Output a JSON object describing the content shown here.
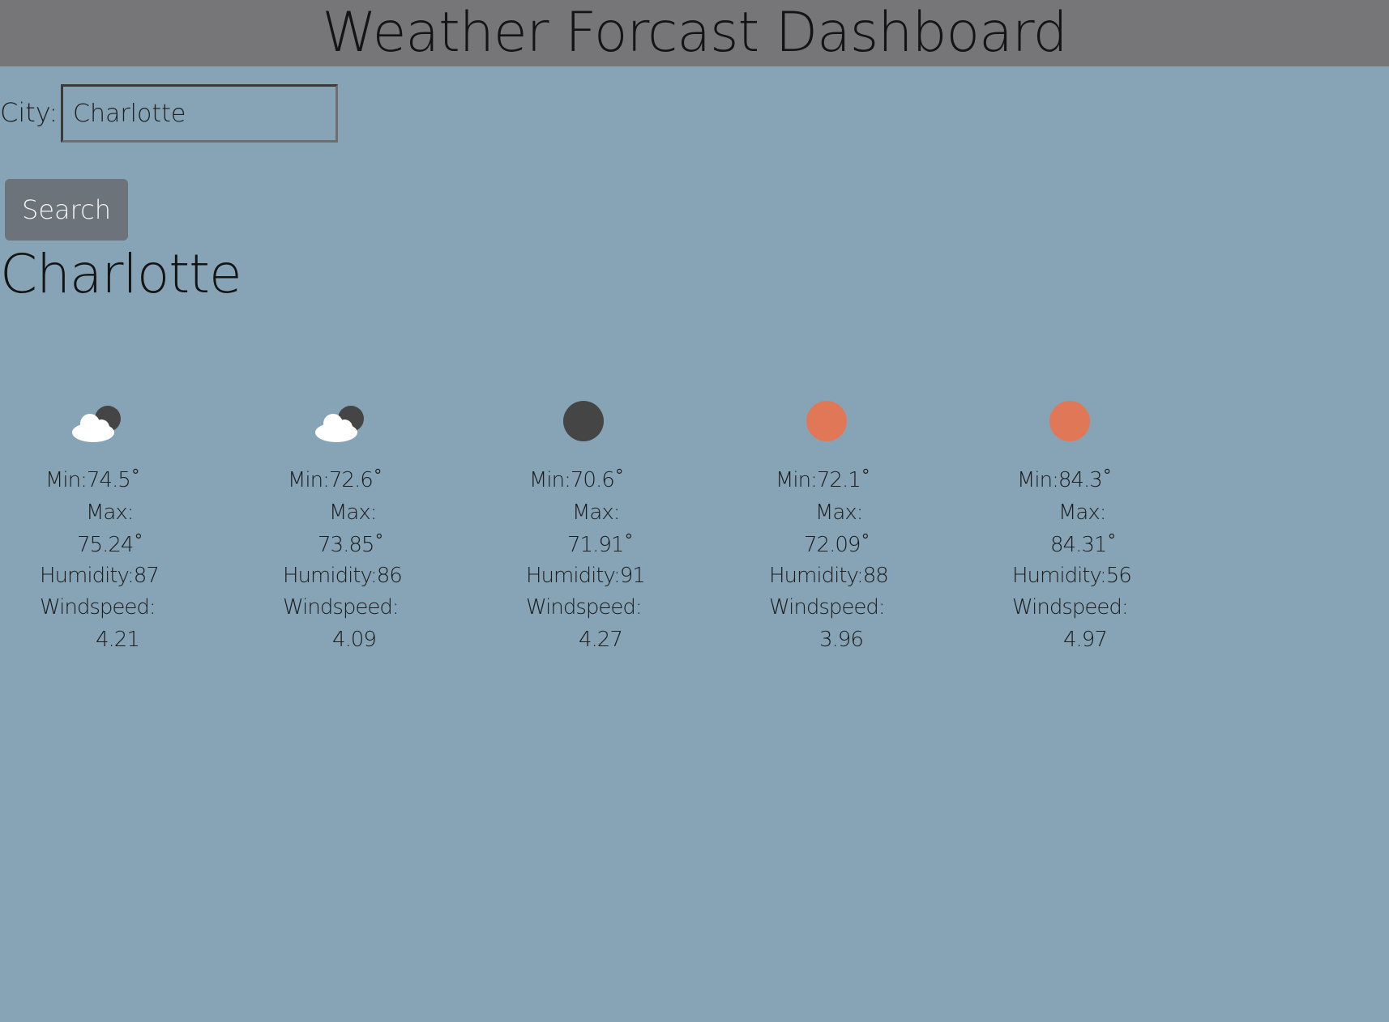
{
  "header": {
    "title": "Weather Forcast Dashboard"
  },
  "search": {
    "label": "City:",
    "value": "Charlotte",
    "button_label": "Search"
  },
  "current": {
    "city": "Charlotte"
  },
  "colors": {
    "background": "#86a4b5",
    "header": "#767679",
    "button": "#6c737b",
    "sun": "#e07857",
    "moon": "#454545",
    "cloud": "#ffffff"
  },
  "forecast": [
    {
      "icon": "cloud-night-icon",
      "min": "Min:74.5˚",
      "max_label": "Max:",
      "max_value": "75.24˚",
      "humidity": "Humidity:87",
      "wind_label": "Windspeed:",
      "wind_value": "4.21"
    },
    {
      "icon": "cloud-night-icon",
      "min": "Min:72.6˚",
      "max_label": "Max:",
      "max_value": "73.85˚",
      "humidity": "Humidity:86",
      "wind_label": "Windspeed:",
      "wind_value": "4.09"
    },
    {
      "icon": "moon-icon",
      "min": "Min:70.6˚",
      "max_label": "Max:",
      "max_value": "71.91˚",
      "humidity": "Humidity:91",
      "wind_label": "Windspeed:",
      "wind_value": "4.27"
    },
    {
      "icon": "sun-icon",
      "min": "Min:72.1˚",
      "max_label": "Max:",
      "max_value": "72.09˚",
      "humidity": "Humidity:88",
      "wind_label": "Windspeed:",
      "wind_value": "3.96"
    },
    {
      "icon": "sun-icon",
      "min": "Min:84.3˚",
      "max_label": "Max:",
      "max_value": "84.31˚",
      "humidity": "Humidity:56",
      "wind_label": "Windspeed:",
      "wind_value": "4.97"
    }
  ]
}
